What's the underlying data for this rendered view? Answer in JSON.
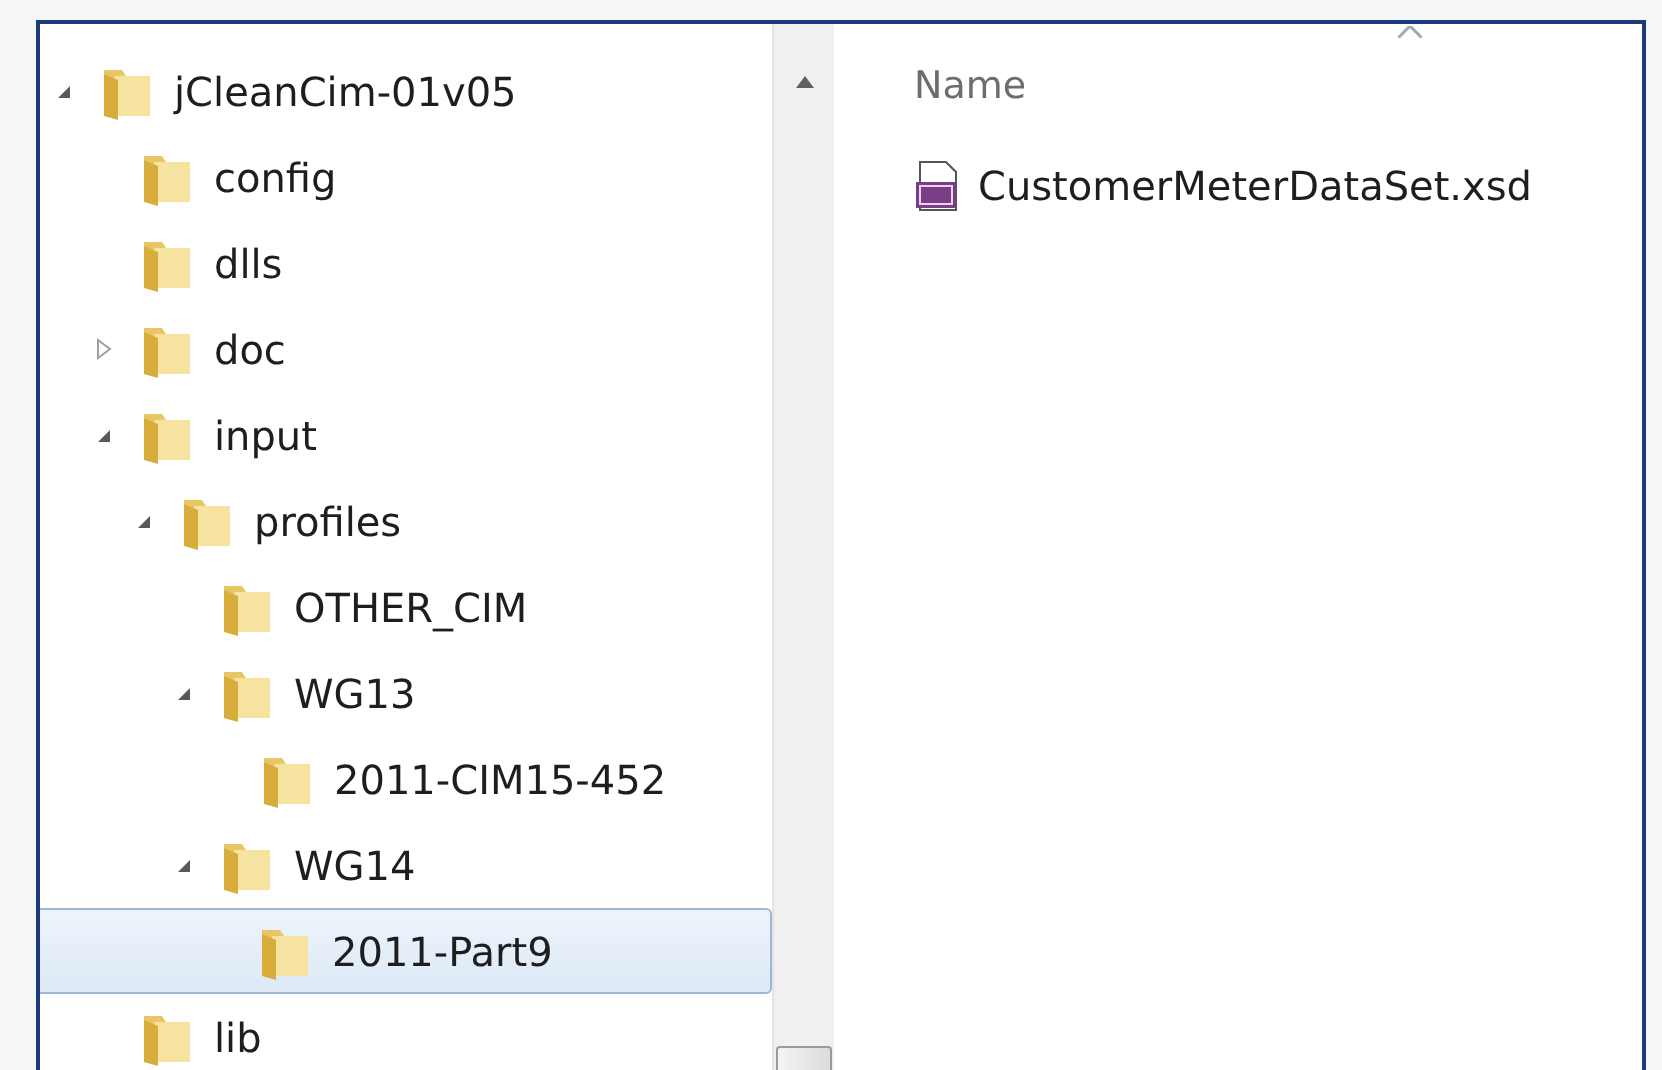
{
  "tree": [
    {
      "label": "jCleanCim-01v05",
      "expanded": true,
      "selected": false,
      "children": [
        {
          "label": "config",
          "selected": false
        },
        {
          "label": "dlls",
          "selected": false
        },
        {
          "label": "doc",
          "expanded": false,
          "selected": false
        },
        {
          "label": "input",
          "expanded": true,
          "selected": false,
          "children": [
            {
              "label": "profiles",
              "expanded": true,
              "selected": false,
              "children": [
                {
                  "label": "OTHER_CIM",
                  "selected": false
                },
                {
                  "label": "WG13",
                  "expanded": true,
                  "selected": false,
                  "children": [
                    {
                      "label": "2011-CIM15-452",
                      "selected": false
                    }
                  ]
                },
                {
                  "label": "WG14",
                  "expanded": true,
                  "selected": false,
                  "children": [
                    {
                      "label": "2011-Part9",
                      "selected": true
                    }
                  ]
                }
              ]
            }
          ]
        },
        {
          "label": "lib",
          "selected": false
        }
      ]
    }
  ],
  "list": {
    "column": "Name",
    "files": [
      {
        "name": "CustomerMeterDataSet.xsd",
        "selected": false
      }
    ]
  }
}
